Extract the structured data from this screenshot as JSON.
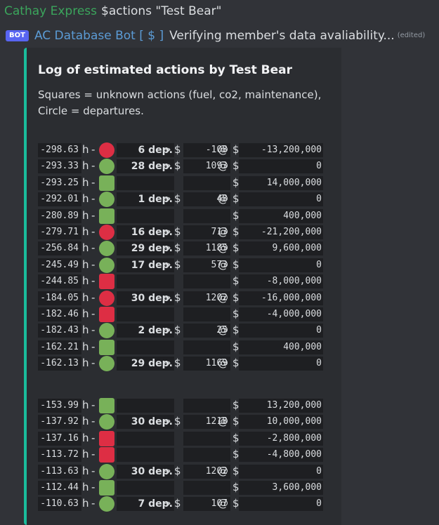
{
  "header": {
    "user": "Cathay Express",
    "command": "$actions \"Test Bear\""
  },
  "bot": {
    "tag": "BOT",
    "name": "AC Database Bot [ $ ]",
    "message": "Verifying member's data avaliability...",
    "edited": "(edited)"
  },
  "embed": {
    "title": "Log of estimated actions by Test Bear",
    "description_line1": "Squares = unknown actions (fuel, co2, maintenance),",
    "description_line2": "Circle = departures.",
    "accent_color": "#1abc9c"
  },
  "symbols": {
    "unit": "h",
    "dash": "-",
    "dep_suffix": "dep.",
    "arrow": "→",
    "dollar": "$",
    "at": "@"
  },
  "blocks": [
    {
      "rows": [
        {
          "hours": "-298.63",
          "shape": "circle",
          "color": "red",
          "dep": "6",
          "price": "-108",
          "amount": "-13,200,000"
        },
        {
          "hours": "-293.33",
          "shape": "circle",
          "color": "green",
          "dep": "28",
          "price": "1093",
          "amount": "0"
        },
        {
          "hours": "-293.25",
          "shape": "square",
          "color": "green",
          "dep": "",
          "price": "",
          "amount": "14,000,000"
        },
        {
          "hours": "-292.01",
          "shape": "circle",
          "color": "green",
          "dep": "1",
          "price": "48",
          "amount": "0"
        },
        {
          "hours": "-280.89",
          "shape": "square",
          "color": "green",
          "dep": "",
          "price": "",
          "amount": "400,000"
        },
        {
          "hours": "-279.71",
          "shape": "circle",
          "color": "red",
          "dep": "16",
          "price": "713",
          "amount": "-21,200,000"
        },
        {
          "hours": "-256.84",
          "shape": "circle",
          "color": "green",
          "dep": "29",
          "price": "1185",
          "amount": "9,600,000"
        },
        {
          "hours": "-245.49",
          "shape": "circle",
          "color": "green",
          "dep": "17",
          "price": "573",
          "amount": "0"
        },
        {
          "hours": "-244.85",
          "shape": "square",
          "color": "red",
          "dep": "",
          "price": "",
          "amount": "-8,000,000"
        },
        {
          "hours": "-184.05",
          "shape": "circle",
          "color": "red",
          "dep": "30",
          "price": "1202",
          "amount": "-16,000,000"
        },
        {
          "hours": "-182.46",
          "shape": "square",
          "color": "red",
          "dep": "",
          "price": "",
          "amount": "-4,000,000"
        },
        {
          "hours": "-182.43",
          "shape": "circle",
          "color": "green",
          "dep": "2",
          "price": "25",
          "amount": "0"
        },
        {
          "hours": "-162.21",
          "shape": "square",
          "color": "green",
          "dep": "",
          "price": "",
          "amount": "400,000"
        },
        {
          "hours": "-162.13",
          "shape": "circle",
          "color": "green",
          "dep": "29",
          "price": "1169",
          "amount": "0"
        }
      ]
    },
    {
      "rows": [
        {
          "hours": "-153.99",
          "shape": "square",
          "color": "green",
          "dep": "",
          "price": "",
          "amount": "13,200,000"
        },
        {
          "hours": "-137.92",
          "shape": "circle",
          "color": "green",
          "dep": "30",
          "price": "1218",
          "amount": "10,000,000"
        },
        {
          "hours": "-137.16",
          "shape": "square",
          "color": "red",
          "dep": "",
          "price": "",
          "amount": "-2,800,000"
        },
        {
          "hours": "-113.72",
          "shape": "square",
          "color": "red",
          "dep": "",
          "price": "",
          "amount": "-4,800,000"
        },
        {
          "hours": "-113.63",
          "shape": "circle",
          "color": "green",
          "dep": "30",
          "price": "1202",
          "amount": "0"
        },
        {
          "hours": "-112.44",
          "shape": "square",
          "color": "green",
          "dep": "",
          "price": "",
          "amount": "3,600,000"
        },
        {
          "hours": "-110.63",
          "shape": "circle",
          "color": "green",
          "dep": "7",
          "price": "107",
          "amount": "0"
        }
      ]
    }
  ]
}
